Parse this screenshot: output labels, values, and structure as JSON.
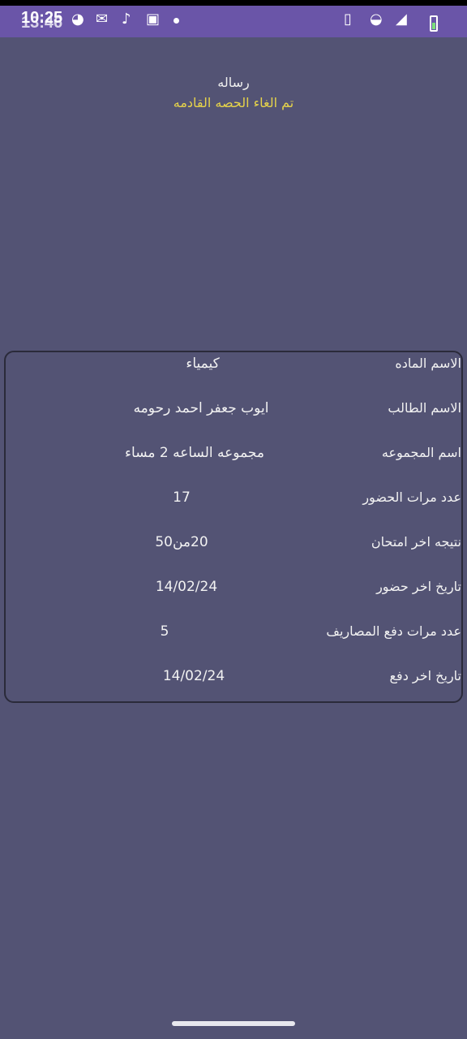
{
  "status_bar": {
    "time": "10:25",
    "time_overlay": "13:46",
    "left_icons": [
      "messenger-icon",
      "gmail-icon",
      "tiktok-icon",
      "linkedin-icon"
    ],
    "right_icons": [
      "vibrate-icon",
      "wifi-icon",
      "signal-icon",
      "battery-icon"
    ]
  },
  "message": {
    "title": "رساله",
    "body": "تم الغاء الحصه القادمه",
    "body_color": "#e6d34a"
  },
  "details": [
    {
      "label": "الاسم الماده",
      "value": "كيمياء"
    },
    {
      "label": "الاسم الطالب",
      "value": "ايوب جعفر احمد رحومه"
    },
    {
      "label": "اسم المجموعه",
      "value": "مجموعه الساعه 2 مساء"
    },
    {
      "label": "عدد مرات الحضور",
      "value": "17"
    },
    {
      "label": "نتيجه اخر امتحان",
      "value": "20من50"
    },
    {
      "label": "تاريخ اخر حضور",
      "value": "14/02/24"
    },
    {
      "label": "عدد مرات دفع المصاريف",
      "value": "5"
    },
    {
      "label": "تاريخ اخر دفع",
      "value": "14/02/24"
    }
  ],
  "colors": {
    "background": "#535374",
    "status_bar": "#6a55a8"
  }
}
